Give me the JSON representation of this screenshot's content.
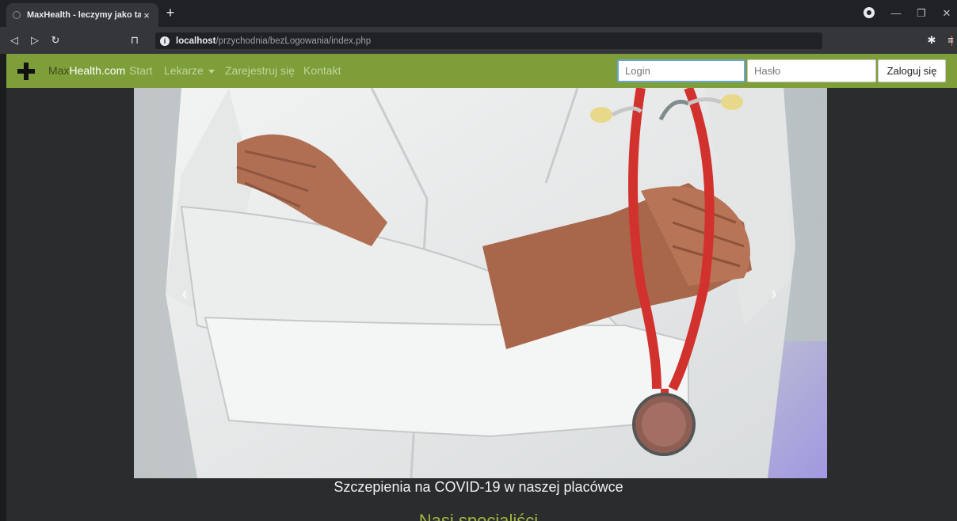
{
  "browser": {
    "tab_title": "MaxHealth - leczymy jako tako",
    "tab_close": "×",
    "new_tab": "+",
    "url_host": "localhost",
    "url_path": "/przychodnia/bezLogowania/index.php",
    "icons": [
      "back-icon",
      "forward-icon",
      "reload-icon",
      "bookmark-icon",
      "info-icon",
      "brave-shield-icon",
      "extensions-icon",
      "menu-icon"
    ]
  },
  "navbar": {
    "brand_part1": "Max",
    "brand_part2": "Health.com",
    "links": [
      "Start",
      "Lekarze",
      "Zarejestruj się",
      "Kontakt"
    ],
    "login_placeholder": "Login",
    "password_placeholder": "Hasło",
    "login_button": "Zaloguj się",
    "colors": {
      "bar": "#7e9e3a",
      "link": "#c2d49a"
    }
  },
  "carousel": {
    "caption": "Szczepienia na COVID-19 w naszej placówce",
    "prev_label": "‹",
    "next_label": "›"
  },
  "section": {
    "heading_partial": "Nasi specjaliści"
  }
}
